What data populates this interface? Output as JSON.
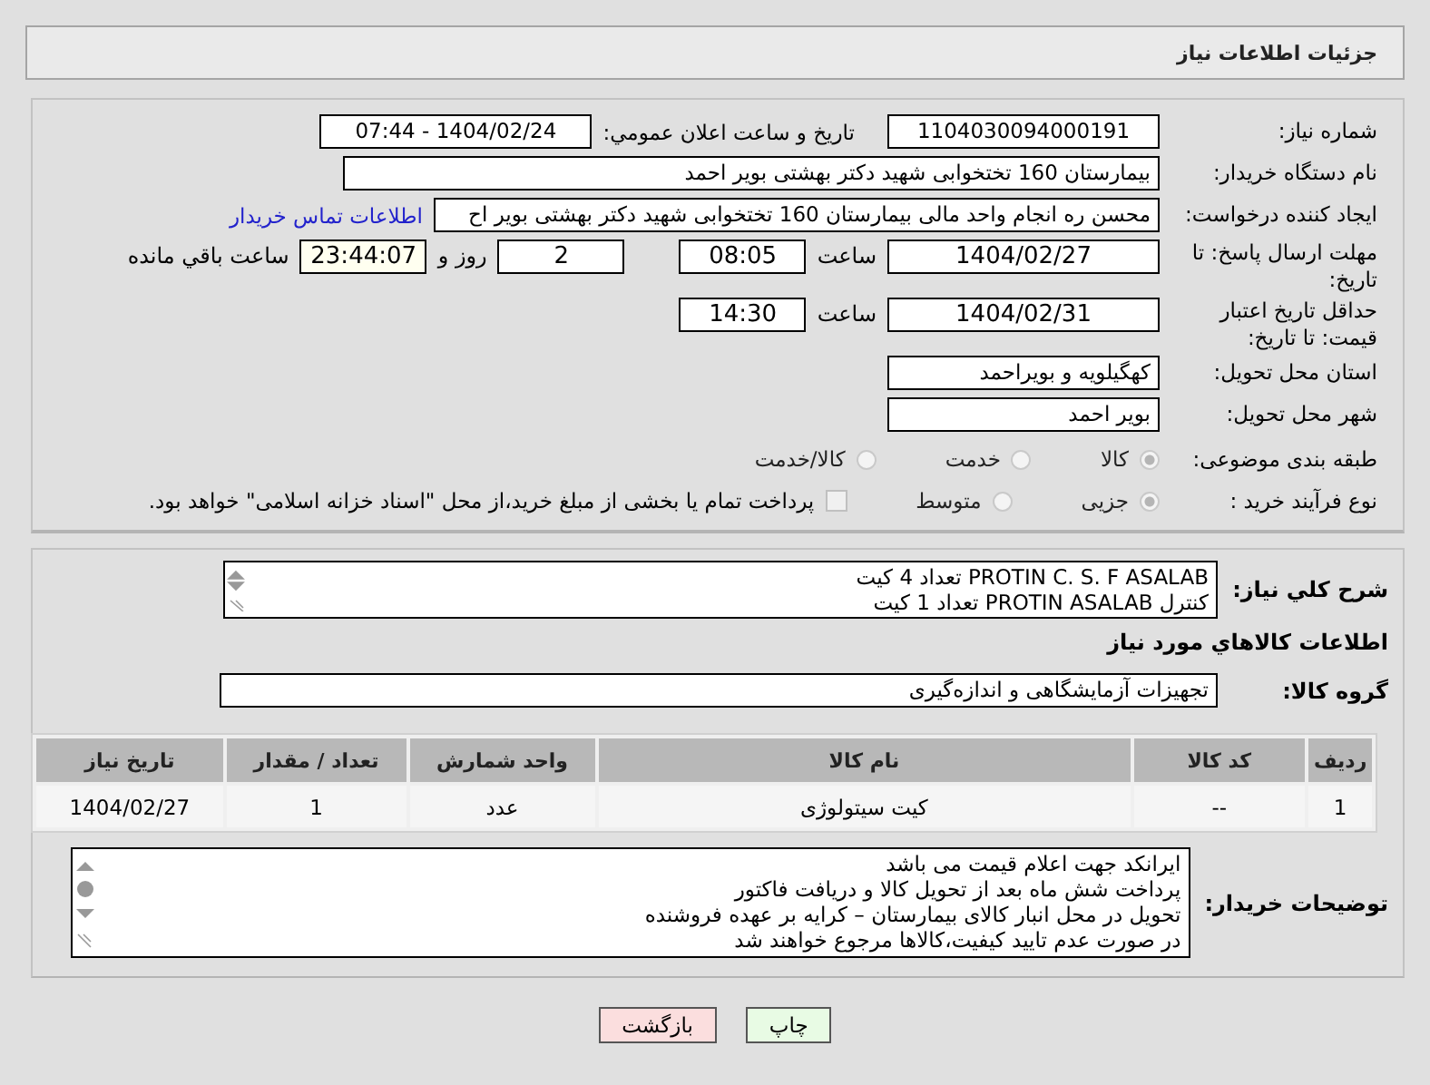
{
  "header": {
    "title": "جزئیات اطلاعات نیاز"
  },
  "need_number": {
    "label": "شماره نیاز:",
    "value": "1104030094000191"
  },
  "announce": {
    "label": "تاریخ و ساعت اعلان عمومي:",
    "value": "1404/02/24 - 07:44"
  },
  "buyer": {
    "label": "نام دستگاه خریدار:",
    "value": "بیمارستان 160 تختخوابی شهید دکتر بهشتی بویر احمد"
  },
  "requester": {
    "label": "ایجاد کننده درخواست:",
    "value": "محسن ره انجام واحد مالی بیمارستان 160 تختخوابی شهید دکتر بهشتی بویر اح",
    "link": "اطلاعات تماس خریدار"
  },
  "deadline": {
    "label": "مهلت ارسال پاسخ: تا تاریخ:",
    "date": "1404/02/27",
    "time_label": "ساعت",
    "time": "08:05",
    "days": "2",
    "days_label": "روز و",
    "remaining": "23:44:07",
    "remaining_label": "ساعت باقي مانده"
  },
  "validity": {
    "label": "حداقل تاریخ اعتبار قیمت: تا تاریخ:",
    "date": "1404/02/31",
    "time_label": "ساعت",
    "time": "14:30"
  },
  "province": {
    "label": "استان محل تحویل:",
    "value": "کهگیلویه و بویراحمد"
  },
  "city": {
    "label": "شهر محل تحویل:",
    "value": "بویر احمد"
  },
  "category": {
    "label": "طبقه بندی موضوعی:",
    "options": [
      {
        "label": "کالا",
        "selected": true
      },
      {
        "label": "خدمت",
        "selected": false
      },
      {
        "label": "کالا/خدمت",
        "selected": false
      }
    ]
  },
  "process": {
    "label": "نوع فرآیند خرید :",
    "options": [
      {
        "label": "جزیی",
        "selected": true
      },
      {
        "label": "متوسط",
        "selected": false
      }
    ],
    "payment": {
      "label": "پرداخت تمام یا بخشی از مبلغ خرید،از محل \"اسناد خزانه اسلامی\" خواهد بود.",
      "checked": false
    }
  },
  "description": {
    "label": "شرح کلي نیاز:",
    "lines": [
      "PROTIN C. S. F ASALAB  تعداد 4 کیت",
      "کنترل PROTIN ASALAB تعداد 1 کیت"
    ]
  },
  "goods_title": "اطلاعات کالاهاي مورد نیاز",
  "goods_group": {
    "label": "گروه کالا:",
    "value": "تجهیزات آزمایشگاهی و اندازه‌گیری"
  },
  "table": {
    "columns": [
      "ردیف",
      "کد کالا",
      "نام کالا",
      "واحد شمارش",
      "تعداد / مقدار",
      "تاریخ نیاز"
    ],
    "rows": [
      [
        "1",
        "--",
        "کیت سیتولوژی",
        "عدد",
        "1",
        "1404/02/27"
      ]
    ]
  },
  "notes": {
    "label": "توضیحات خریدار:",
    "lines": [
      "ایرانکد جهت اعلام قیمت می باشد",
      "پرداخت شش ماه بعد از تحویل کالا و دریافت فاکتور",
      "تحویل در محل انبار کالای بیمارستان – کرایه بر عهده فروشنده",
      "در صورت عدم تایید کیفیت،کالاها مرجوع خواهند شد"
    ]
  },
  "buttons": [
    {
      "label": "چاپ",
      "kind": "print"
    },
    {
      "label": "بازگشت",
      "kind": "back"
    }
  ]
}
